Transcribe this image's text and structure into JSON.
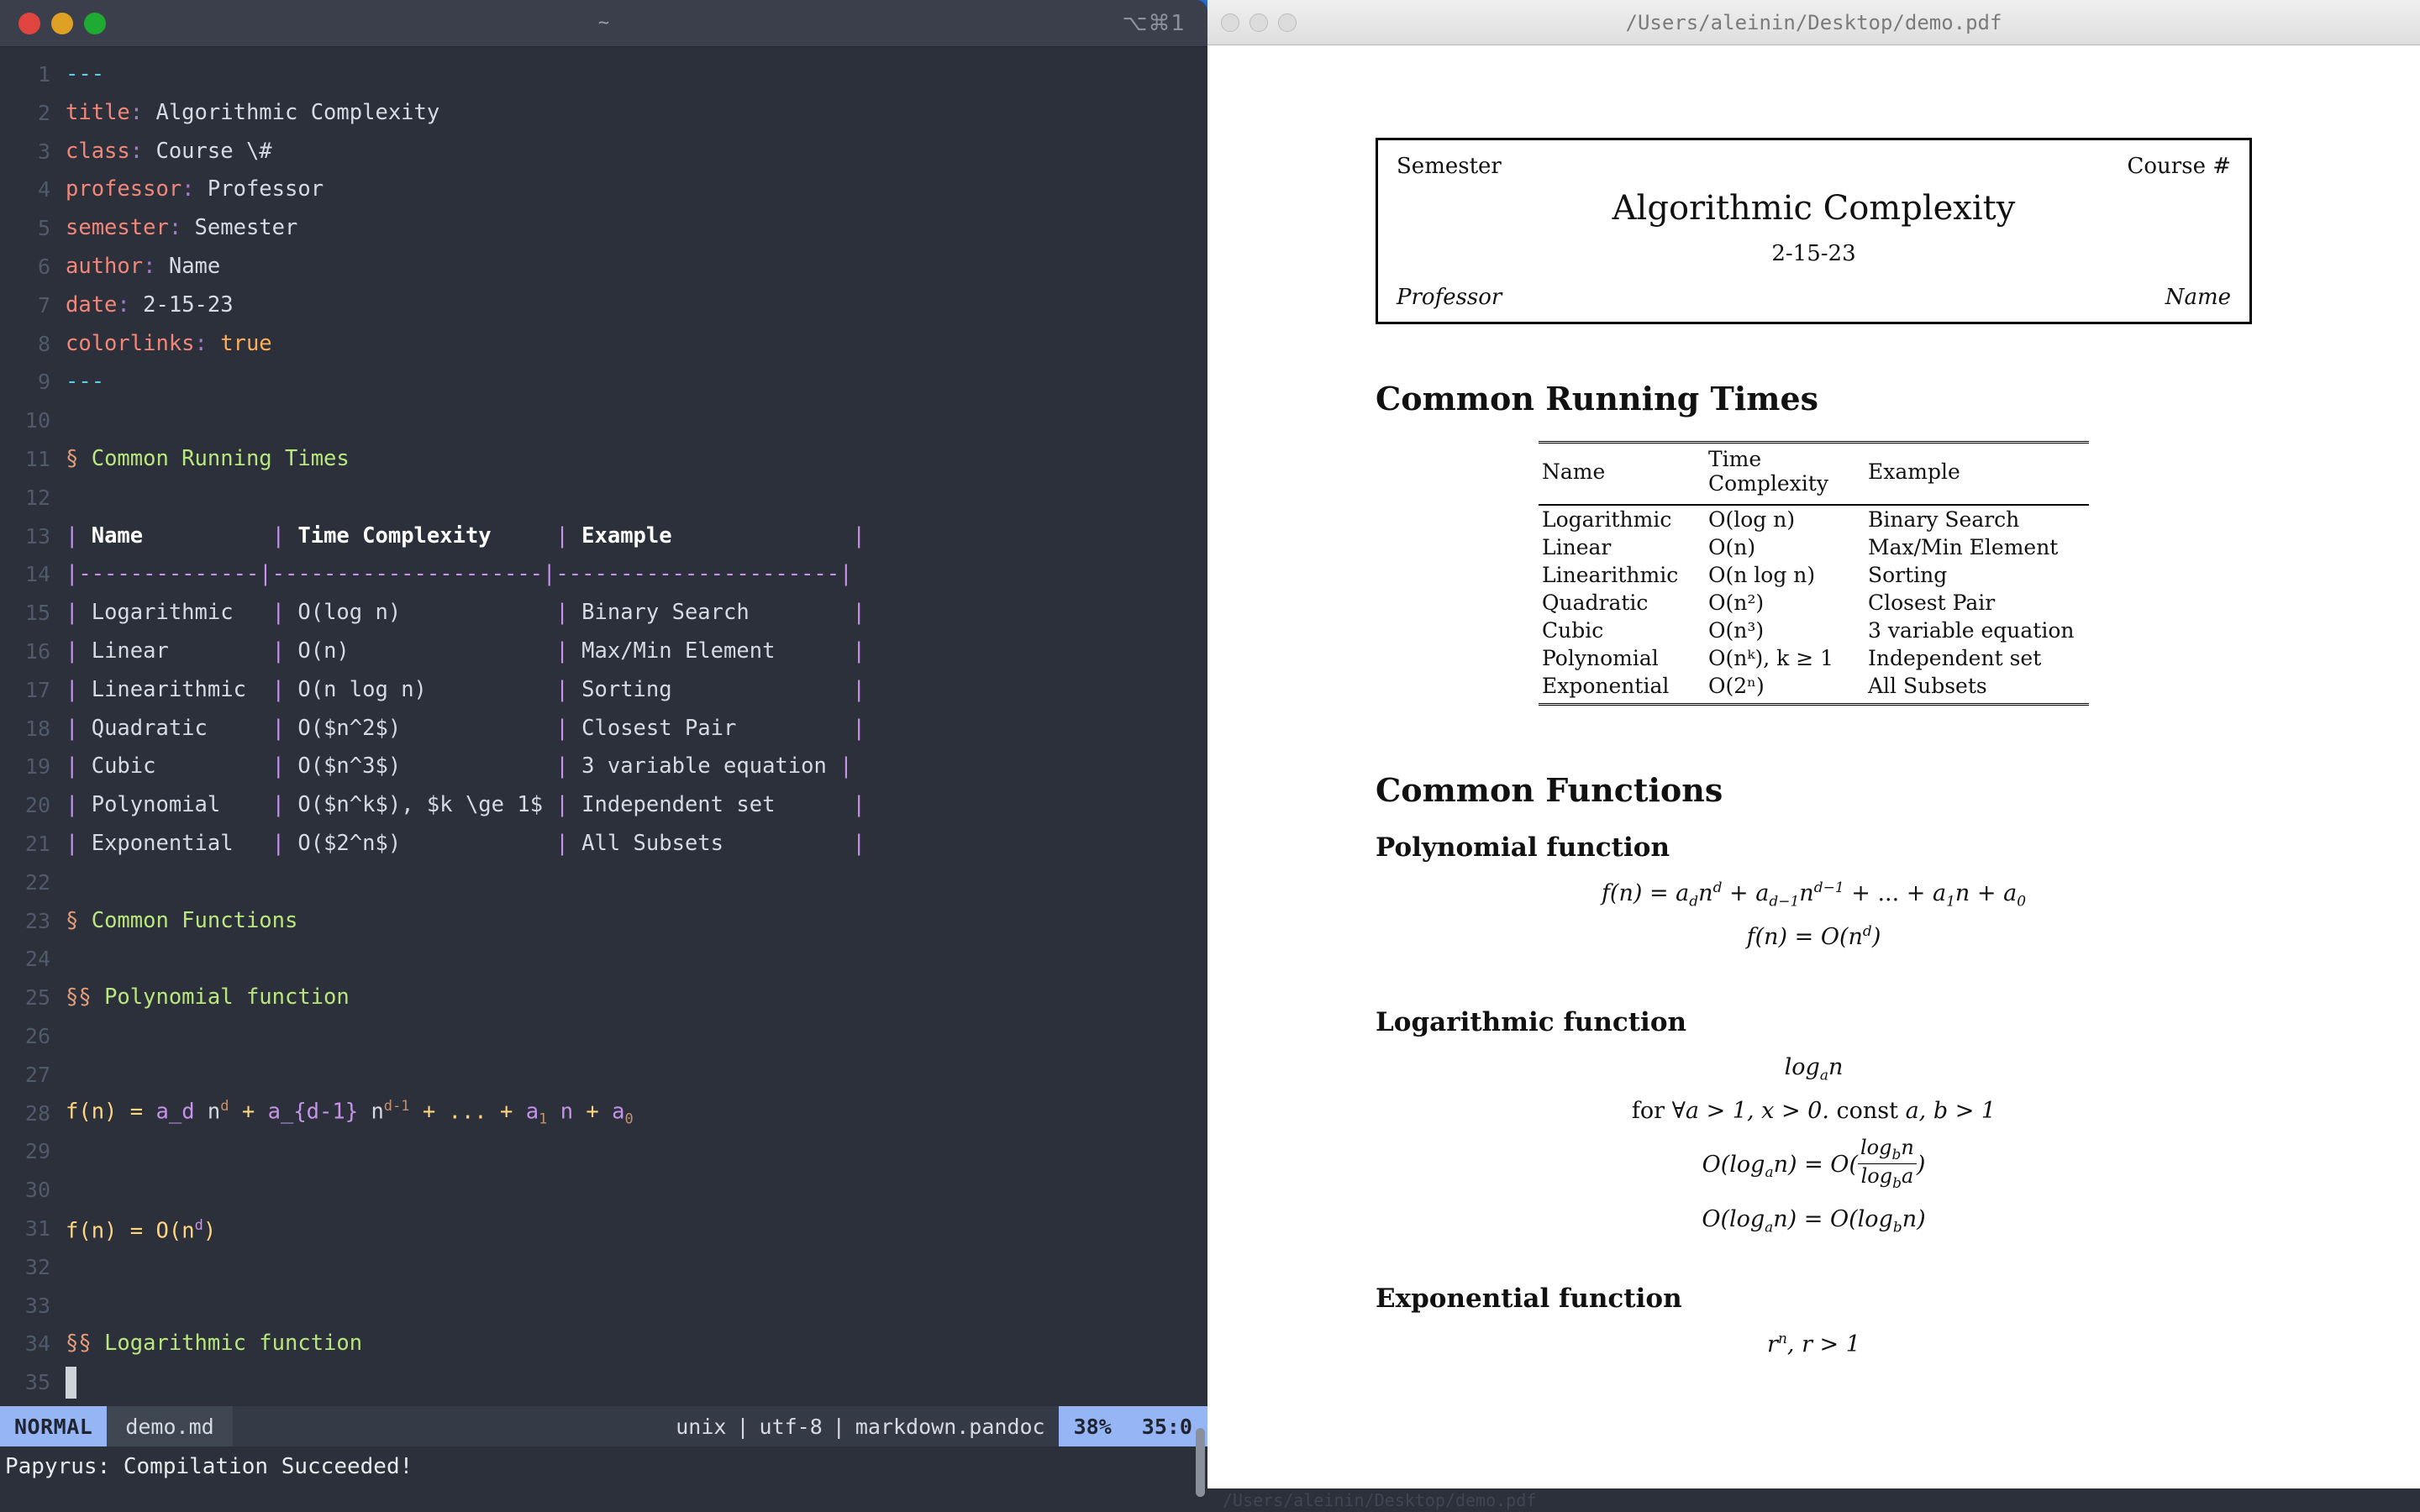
{
  "terminal": {
    "title": "~",
    "shortcut": "⌥⌘1",
    "window_controls": [
      "close",
      "minimize",
      "maximize"
    ],
    "statusline": {
      "mode": "NORMAL",
      "filename": "demo.md",
      "fileformat": "unix",
      "encoding": "utf-8",
      "filetype": "markdown.pandoc",
      "separator": "|",
      "percent": "38%",
      "position": "35:0"
    },
    "message": "Papyrus: Compilation Succeeded!",
    "lines": [
      {
        "n": "1",
        "segs": [
          {
            "t": "---",
            "c": "s-dash"
          }
        ]
      },
      {
        "n": "2",
        "segs": [
          {
            "t": "title",
            "c": "s-key"
          },
          {
            "t": ":",
            "c": "s-colon"
          },
          {
            "t": " Algorithmic Complexity",
            "c": "s-val"
          }
        ]
      },
      {
        "n": "3",
        "segs": [
          {
            "t": "class",
            "c": "s-key"
          },
          {
            "t": ":",
            "c": "s-colon"
          },
          {
            "t": " Course \\#",
            "c": "s-val"
          }
        ]
      },
      {
        "n": "4",
        "segs": [
          {
            "t": "professor",
            "c": "s-key"
          },
          {
            "t": ":",
            "c": "s-colon"
          },
          {
            "t": " Professor",
            "c": "s-val"
          }
        ]
      },
      {
        "n": "5",
        "segs": [
          {
            "t": "semester",
            "c": "s-key"
          },
          {
            "t": ":",
            "c": "s-colon"
          },
          {
            "t": " Semester",
            "c": "s-val"
          }
        ]
      },
      {
        "n": "6",
        "segs": [
          {
            "t": "author",
            "c": "s-key"
          },
          {
            "t": ":",
            "c": "s-colon"
          },
          {
            "t": " Name",
            "c": "s-val"
          }
        ]
      },
      {
        "n": "7",
        "segs": [
          {
            "t": "date",
            "c": "s-key"
          },
          {
            "t": ":",
            "c": "s-colon"
          },
          {
            "t": " 2-15-23",
            "c": "s-val"
          }
        ]
      },
      {
        "n": "8",
        "segs": [
          {
            "t": "colorlinks",
            "c": "s-key"
          },
          {
            "t": ":",
            "c": "s-colon"
          },
          {
            "t": " ",
            "c": "s-val"
          },
          {
            "t": "true",
            "c": "s-bool"
          }
        ]
      },
      {
        "n": "9",
        "segs": [
          {
            "t": "---",
            "c": "s-dash"
          }
        ]
      },
      {
        "n": "10",
        "segs": []
      },
      {
        "n": "11",
        "segs": [
          {
            "t": "§",
            "c": "s-hmark"
          },
          {
            "t": " Common Running Times",
            "c": "s-head"
          }
        ]
      },
      {
        "n": "12",
        "segs": []
      },
      {
        "n": "13",
        "segs": [
          {
            "t": "| ",
            "c": "s-pipe"
          },
          {
            "t": "Name          ",
            "c": "s-bold"
          },
          {
            "t": "| ",
            "c": "s-pipe"
          },
          {
            "t": "Time Complexity     ",
            "c": "s-bold"
          },
          {
            "t": "| ",
            "c": "s-pipe"
          },
          {
            "t": "Example              ",
            "c": "s-bold"
          },
          {
            "t": "|",
            "c": "s-pipe"
          }
        ]
      },
      {
        "n": "14",
        "segs": [
          {
            "t": "|--------------|---------------------|----------------------|",
            "c": "s-pipe"
          }
        ]
      },
      {
        "n": "15",
        "segs": [
          {
            "t": "| ",
            "c": "s-pipe"
          },
          {
            "t": "Logarithmic   ",
            "c": "s-txt"
          },
          {
            "t": "| ",
            "c": "s-pipe"
          },
          {
            "t": "O(log n)            ",
            "c": "s-txt"
          },
          {
            "t": "| ",
            "c": "s-pipe"
          },
          {
            "t": "Binary Search        ",
            "c": "s-txt"
          },
          {
            "t": "|",
            "c": "s-pipe"
          }
        ]
      },
      {
        "n": "16",
        "segs": [
          {
            "t": "| ",
            "c": "s-pipe"
          },
          {
            "t": "Linear        ",
            "c": "s-txt"
          },
          {
            "t": "| ",
            "c": "s-pipe"
          },
          {
            "t": "O(n)                ",
            "c": "s-txt"
          },
          {
            "t": "| ",
            "c": "s-pipe"
          },
          {
            "t": "Max/Min Element      ",
            "c": "s-txt"
          },
          {
            "t": "|",
            "c": "s-pipe"
          }
        ]
      },
      {
        "n": "17",
        "segs": [
          {
            "t": "| ",
            "c": "s-pipe"
          },
          {
            "t": "Linearithmic  ",
            "c": "s-txt"
          },
          {
            "t": "| ",
            "c": "s-pipe"
          },
          {
            "t": "O(n log n)          ",
            "c": "s-txt"
          },
          {
            "t": "| ",
            "c": "s-pipe"
          },
          {
            "t": "Sorting              ",
            "c": "s-txt"
          },
          {
            "t": "|",
            "c": "s-pipe"
          }
        ]
      },
      {
        "n": "18",
        "segs": [
          {
            "t": "| ",
            "c": "s-pipe"
          },
          {
            "t": "Quadratic     ",
            "c": "s-txt"
          },
          {
            "t": "| ",
            "c": "s-pipe"
          },
          {
            "t": "O($n^2$)            ",
            "c": "s-txt"
          },
          {
            "t": "| ",
            "c": "s-pipe"
          },
          {
            "t": "Closest Pair         ",
            "c": "s-txt"
          },
          {
            "t": "|",
            "c": "s-pipe"
          }
        ]
      },
      {
        "n": "19",
        "segs": [
          {
            "t": "| ",
            "c": "s-pipe"
          },
          {
            "t": "Cubic         ",
            "c": "s-txt"
          },
          {
            "t": "| ",
            "c": "s-pipe"
          },
          {
            "t": "O($n^3$)            ",
            "c": "s-txt"
          },
          {
            "t": "| ",
            "c": "s-pipe"
          },
          {
            "t": "3 variable equation ",
            "c": "s-txt"
          },
          {
            "t": "|",
            "c": "s-pipe"
          }
        ]
      },
      {
        "n": "20",
        "segs": [
          {
            "t": "| ",
            "c": "s-pipe"
          },
          {
            "t": "Polynomial    ",
            "c": "s-txt"
          },
          {
            "t": "| ",
            "c": "s-pipe"
          },
          {
            "t": "O($n^k$), $k \\ge 1$ ",
            "c": "s-txt"
          },
          {
            "t": "| ",
            "c": "s-pipe"
          },
          {
            "t": "Independent set      ",
            "c": "s-txt"
          },
          {
            "t": "|",
            "c": "s-pipe"
          }
        ]
      },
      {
        "n": "21",
        "segs": [
          {
            "t": "| ",
            "c": "s-pipe"
          },
          {
            "t": "Exponential   ",
            "c": "s-txt"
          },
          {
            "t": "| ",
            "c": "s-pipe"
          },
          {
            "t": "O($2^n$)            ",
            "c": "s-txt"
          },
          {
            "t": "| ",
            "c": "s-pipe"
          },
          {
            "t": "All Subsets          ",
            "c": "s-txt"
          },
          {
            "t": "|",
            "c": "s-pipe"
          }
        ]
      },
      {
        "n": "22",
        "segs": []
      },
      {
        "n": "23",
        "segs": [
          {
            "t": "§",
            "c": "s-hmark"
          },
          {
            "t": " Common Functions",
            "c": "s-head"
          }
        ]
      },
      {
        "n": "24",
        "segs": []
      },
      {
        "n": "25",
        "segs": [
          {
            "t": "§§",
            "c": "s-hmark"
          },
          {
            "t": " Polynomial function",
            "c": "s-head"
          }
        ]
      },
      {
        "n": "26",
        "segs": []
      },
      {
        "n": "27",
        "segs": []
      },
      {
        "n": "28",
        "segs": [
          {
            "t": "f(n)",
            "c": "s-op"
          },
          {
            "t": " ",
            "c": "s-txt"
          },
          {
            "t": "=",
            "c": "s-op"
          },
          {
            "t": " ",
            "c": "s-txt"
          },
          {
            "t": "a_d",
            "c": "s-var"
          },
          {
            "t": " ",
            "c": "s-txt"
          },
          {
            "t": "n",
            "c": "s-txt"
          },
          {
            "t": "d",
            "c": "s-sup"
          },
          {
            "t": " ",
            "c": "s-txt"
          },
          {
            "t": "+",
            "c": "s-op"
          },
          {
            "t": " ",
            "c": "s-txt"
          },
          {
            "t": "a_{d-1}",
            "c": "s-var"
          },
          {
            "t": " ",
            "c": "s-txt"
          },
          {
            "t": "n",
            "c": "s-txt"
          },
          {
            "t": "d-1",
            "c": "s-sup"
          },
          {
            "t": " ",
            "c": "s-txt"
          },
          {
            "t": "+",
            "c": "s-op"
          },
          {
            "t": " ",
            "c": "s-txt"
          },
          {
            "t": "...",
            "c": "s-op"
          },
          {
            "t": " ",
            "c": "s-txt"
          },
          {
            "t": "+",
            "c": "s-op"
          },
          {
            "t": " ",
            "c": "s-txt"
          },
          {
            "t": "a",
            "c": "s-var"
          },
          {
            "t": "1",
            "c": "s-sub"
          },
          {
            "t": " ",
            "c": "s-txt"
          },
          {
            "t": "n",
            "c": "s-var"
          },
          {
            "t": " ",
            "c": "s-txt"
          },
          {
            "t": "+",
            "c": "s-op"
          },
          {
            "t": " ",
            "c": "s-txt"
          },
          {
            "t": "a",
            "c": "s-var"
          },
          {
            "t": "0",
            "c": "s-sub"
          }
        ]
      },
      {
        "n": "29",
        "segs": []
      },
      {
        "n": "30",
        "segs": []
      },
      {
        "n": "31",
        "segs": [
          {
            "t": "f(n)",
            "c": "s-op"
          },
          {
            "t": " ",
            "c": "s-txt"
          },
          {
            "t": "=",
            "c": "s-op"
          },
          {
            "t": " ",
            "c": "s-txt"
          },
          {
            "t": "O(n",
            "c": "s-op"
          },
          {
            "t": "d",
            "c": "s-supv"
          },
          {
            "t": ")",
            "c": "s-op"
          }
        ]
      },
      {
        "n": "32",
        "segs": []
      },
      {
        "n": "33",
        "segs": []
      },
      {
        "n": "34",
        "segs": [
          {
            "t": "§§",
            "c": "s-hmark"
          },
          {
            "t": " Logarithmic function",
            "c": "s-head"
          }
        ]
      },
      {
        "n": "35",
        "segs": [],
        "cursor": true
      }
    ]
  },
  "pdf": {
    "window_title": "/Users/aleinin/Desktop/demo.pdf",
    "footer_path": "/Users/aleinin/Desktop/demo.pdf",
    "titleblock": {
      "semester": "Semester",
      "course": "Course #",
      "title": "Algorithmic Complexity",
      "date": "2-15-23",
      "professor": "Professor",
      "author": "Name"
    },
    "section_running_times": "Common Running Times",
    "section_functions": "Common Functions",
    "sub_polynomial": "Polynomial function",
    "sub_logarithmic": "Logarithmic function",
    "sub_exponential": "Exponential function",
    "table": {
      "headers": [
        "Name",
        "Time Complexity",
        "Example"
      ],
      "rows": [
        [
          "Logarithmic",
          "O(log n)",
          "Binary Search"
        ],
        [
          "Linear",
          "O(n)",
          "Max/Min Element"
        ],
        [
          "Linearithmic",
          "O(n log n)",
          "Sorting"
        ],
        [
          "Quadratic",
          "O(n²)",
          "Closest Pair"
        ],
        [
          "Cubic",
          "O(n³)",
          "3 variable equation"
        ],
        [
          "Polynomial",
          "O(nᵏ), k ≥ 1",
          "Independent set"
        ],
        [
          "Exponential",
          "O(2ⁿ)",
          "All Subsets"
        ]
      ]
    },
    "equations": {
      "poly1": "f(n) = a_d n^d + a_{d-1} n^{d-1} + ... + a_1 n + a_0",
      "poly2": "f(n) = O(n^d)",
      "log1": "log_a n",
      "log2": "for ∀a > 1, x > 0. const a, b > 1",
      "log3": "O(log_a n) = O( log_b n / log_b a )",
      "log4": "O(log_a n) = O(log_b n)",
      "exp1": "r^n, r > 1"
    }
  },
  "colors": {
    "terminal_bg": "#2b303b",
    "terminal_titlebar": "#3a3f4b",
    "accent_blue": "#96b5f5",
    "keyword_red": "#f28779",
    "heading_green": "#bae67e",
    "pipe_purple": "#c792ea",
    "operator_yellow": "#ffd580",
    "desktop_blue": "#2d7ff9"
  }
}
